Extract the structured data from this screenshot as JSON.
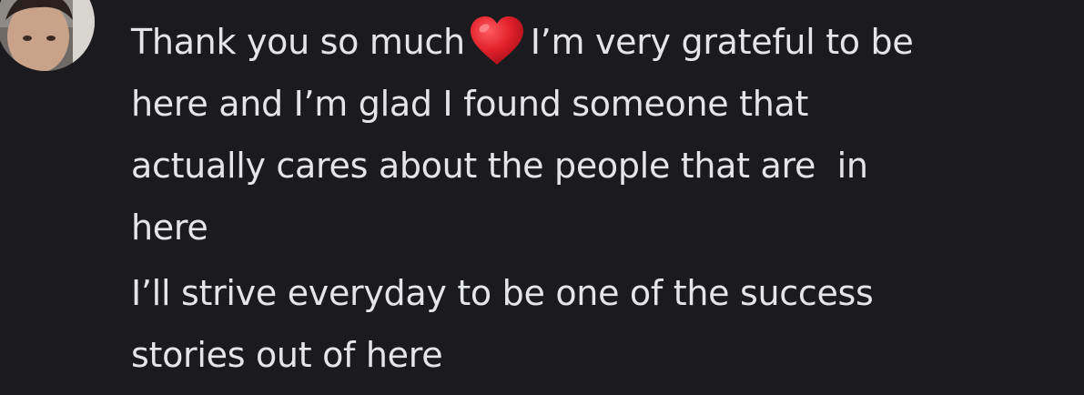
{
  "message": {
    "paragraph1": {
      "line1_before_emoji": "Thank you so much",
      "emoji": "red-heart",
      "line1_after_emoji": "I’m very grateful to be",
      "line2": "here and I’m glad I found someone that",
      "line3": "actually cares about the people that are  in",
      "line4": "here"
    },
    "paragraph2": {
      "line1": "I’ll strive everyday to be one of the success",
      "line2": "stories out of here"
    }
  },
  "colors": {
    "background": "#1b1b1f",
    "text": "#e4e5e8",
    "heart": "#e0202a"
  }
}
